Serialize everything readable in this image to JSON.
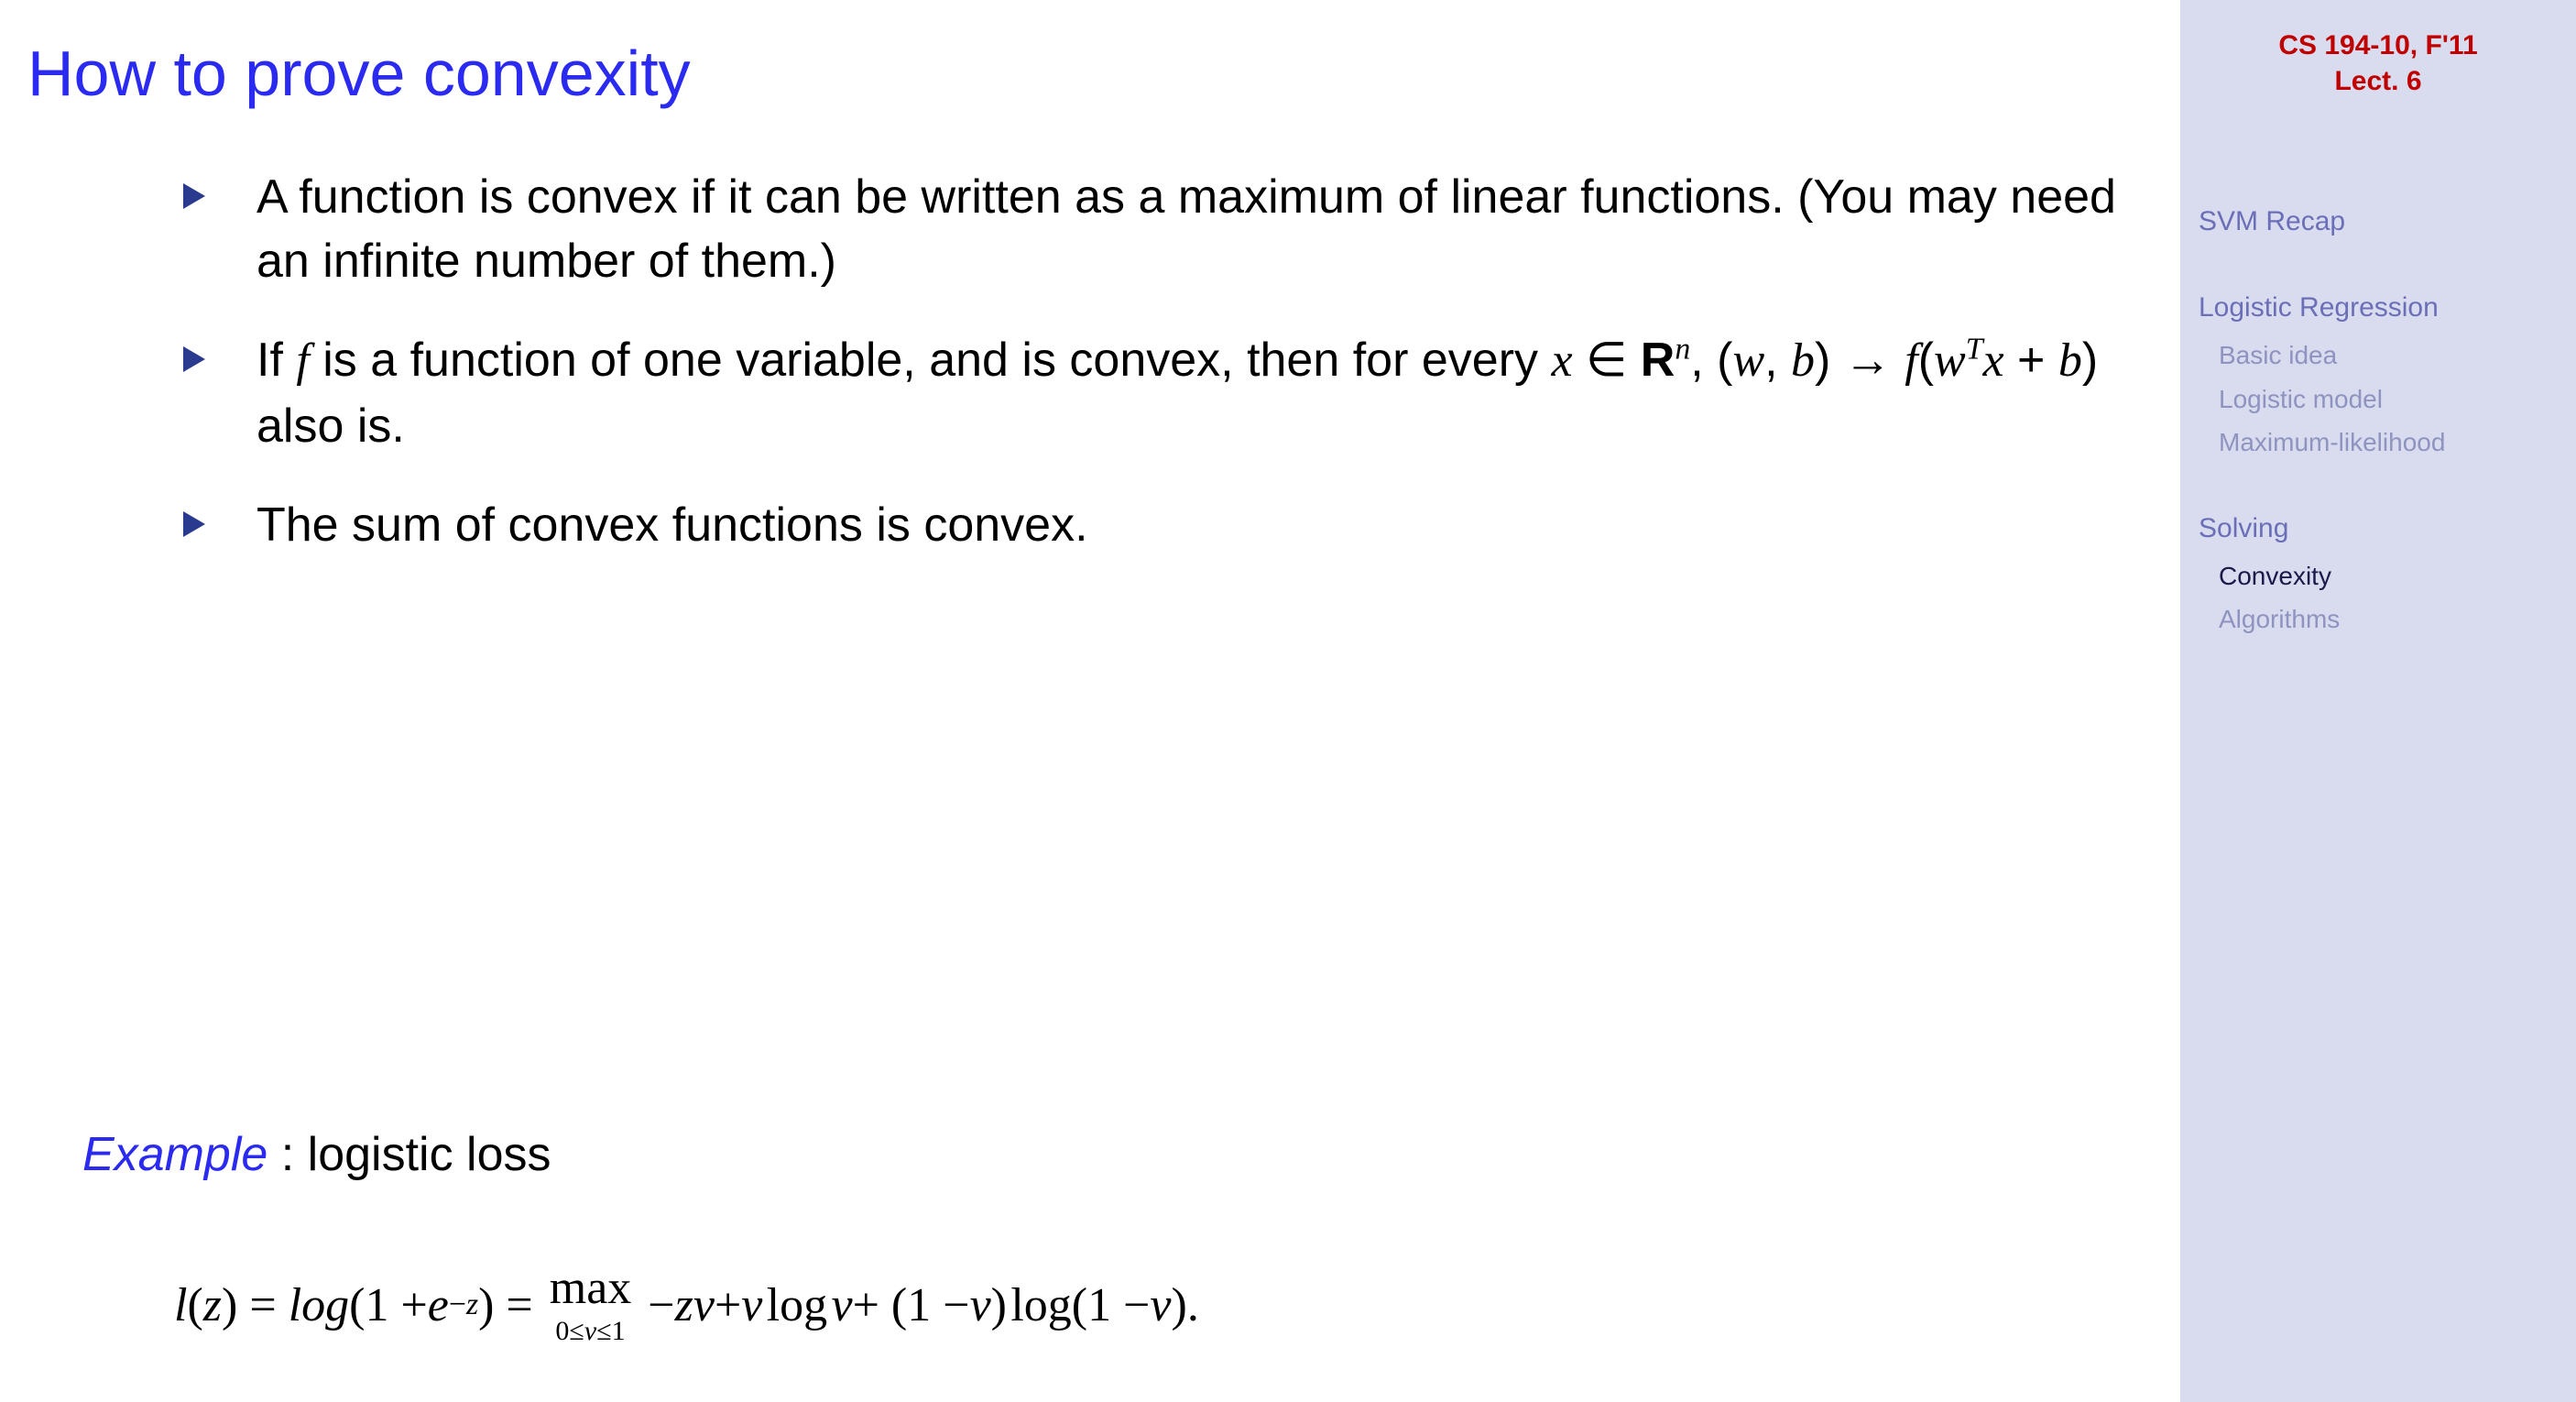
{
  "title": "How to prove convexity",
  "bullets": {
    "b1": "A function is convex if it can be written as a maximum of linear functions. (You may need an infinite number of them.)",
    "b3": "The sum of convex functions is convex."
  },
  "example": {
    "label": "Example",
    "suffix": " : logistic loss"
  },
  "sidebar": {
    "course": "CS 194-10, F'11",
    "lecture": "Lect. 6",
    "sections": {
      "s1": {
        "title": "SVM Recap",
        "items": []
      },
      "s2": {
        "title": "Logistic Regression",
        "items": [
          "Basic idea",
          "Logistic model",
          "Maximum-likelihood"
        ]
      },
      "s3": {
        "title": "Solving",
        "items": [
          "Convexity",
          "Algorithms"
        ],
        "active": "Convexity"
      }
    }
  }
}
